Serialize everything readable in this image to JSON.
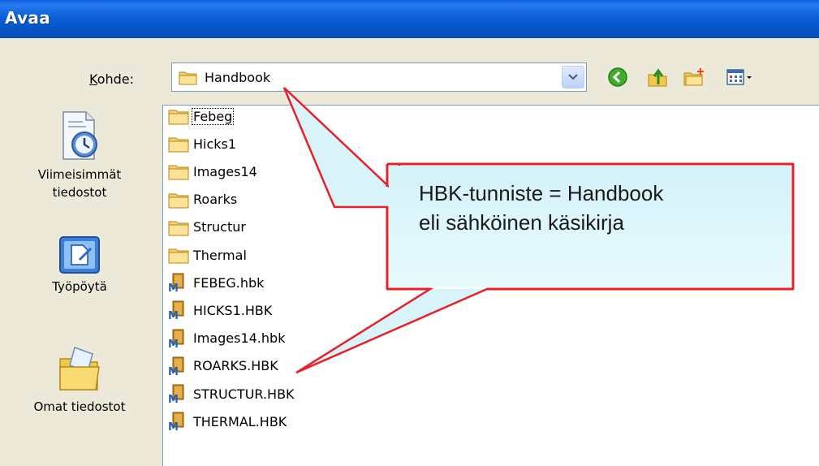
{
  "window": {
    "title": "Avaa"
  },
  "lookin": {
    "label_prefix": "",
    "label_accel": "K",
    "label_rest": "ohde:",
    "value": "Handbook"
  },
  "toolbar": {
    "icons": [
      "back-icon",
      "up-folder-icon",
      "new-folder-icon",
      "views-menu-icon"
    ]
  },
  "places": [
    {
      "line1": "Viimeisimmät",
      "line2": "tiedostot",
      "icon": "recent-documents-icon"
    },
    {
      "line1": "Työpöytä",
      "line2": "",
      "icon": "desktop-icon"
    },
    {
      "line1": "Omat tiedostot",
      "line2": "",
      "icon": "my-documents-icon"
    }
  ],
  "files": [
    {
      "name": "Febeg",
      "type": "folder"
    },
    {
      "name": "Hicks1",
      "type": "folder"
    },
    {
      "name": "Images14",
      "type": "folder"
    },
    {
      "name": "Roarks",
      "type": "folder"
    },
    {
      "name": "Structur",
      "type": "folder"
    },
    {
      "name": "Thermal",
      "type": "folder"
    },
    {
      "name": "FEBEG.hbk",
      "type": "hbk"
    },
    {
      "name": "HICKS1.HBK",
      "type": "hbk"
    },
    {
      "name": "Images14.hbk",
      "type": "hbk"
    },
    {
      "name": "ROARKS.HBK",
      "type": "hbk"
    },
    {
      "name": "STRUCTUR.HBK",
      "type": "hbk"
    },
    {
      "name": "THERMAL.HBK",
      "type": "hbk"
    }
  ],
  "callout": {
    "line1": "HBK-tunniste = Handbook",
    "line2": "eli sähköinen käsikirja"
  }
}
